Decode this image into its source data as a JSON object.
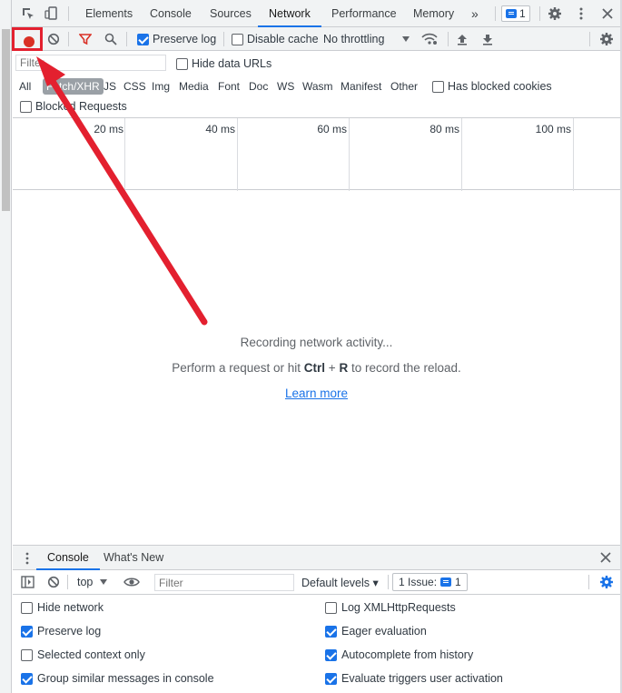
{
  "devtools": {
    "tabs": [
      {
        "label": "Elements"
      },
      {
        "label": "Console"
      },
      {
        "label": "Sources"
      },
      {
        "label": "Network"
      },
      {
        "label": "Performance"
      },
      {
        "label": "Memory"
      }
    ],
    "more_tabs": "»",
    "issues_count": "1",
    "accent_color": "#1a73e8"
  },
  "network_toolbar": {
    "preserve_log": {
      "label": "Preserve log",
      "checked": true
    },
    "disable_cache": {
      "label": "Disable cache",
      "checked": false
    },
    "throttling": "No throttling"
  },
  "filter_bar": {
    "filter_placeholder": "Filter",
    "hide_data_urls": "Hide data URLs",
    "types": [
      "All",
      "Fetch/XHR",
      "JS",
      "CSS",
      "Img",
      "Media",
      "Font",
      "Doc",
      "WS",
      "Wasm",
      "Manifest",
      "Other"
    ],
    "active_type": "Fetch/XHR",
    "has_blocked_cookies": "Has blocked cookies",
    "blocked_requests": "Blocked Requests"
  },
  "timeline": {
    "ticks": [
      "20 ms",
      "40 ms",
      "60 ms",
      "80 ms",
      "100 ms"
    ]
  },
  "empty_state": {
    "line1": "Recording network activity...",
    "line2_prefix": "Perform a request or hit ",
    "line2_key1": "Ctrl",
    "line2_plus": " + ",
    "line2_key2": "R",
    "line2_suffix": " to record the reload.",
    "learn_more": "Learn more"
  },
  "drawer": {
    "tabs": [
      {
        "label": "Console"
      },
      {
        "label": "What's New"
      }
    ],
    "context": "top",
    "filter_placeholder": "Filter",
    "default_levels": "Default levels ▾",
    "issues_label": "1 Issue:",
    "issues_count": "1"
  },
  "console_settings": {
    "left": [
      {
        "label": "Hide network",
        "checked": false
      },
      {
        "label": "Preserve log",
        "checked": true
      },
      {
        "label": "Selected context only",
        "checked": false
      },
      {
        "label": "Group similar messages in console",
        "checked": true
      }
    ],
    "right": [
      {
        "label": "Log XMLHttpRequests",
        "checked": false
      },
      {
        "label": "Eager evaluation",
        "checked": true
      },
      {
        "label": "Autocomplete from history",
        "checked": true
      },
      {
        "label": "Evaluate triggers user activation",
        "checked": true
      }
    ]
  },
  "annotation": {
    "highlight_color": "#e3202f"
  }
}
